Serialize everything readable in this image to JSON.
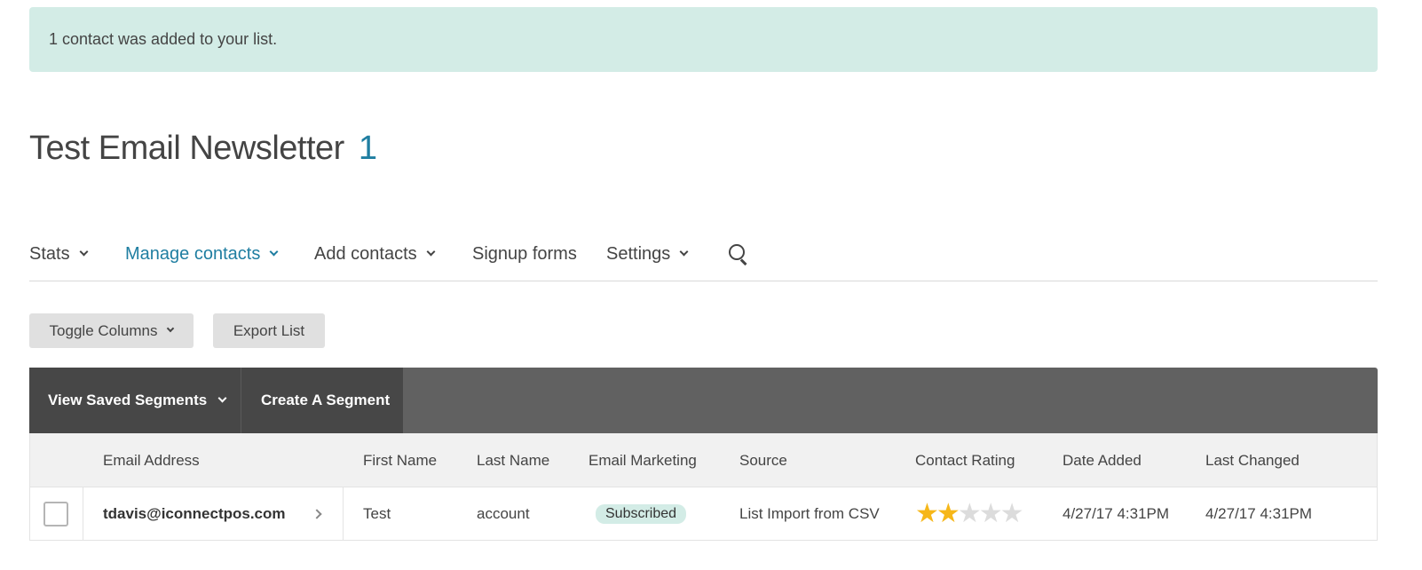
{
  "banner": {
    "message": "1 contact was added to your list."
  },
  "list": {
    "title": "Test Email Newsletter",
    "count": "1"
  },
  "nav": {
    "stats": "Stats",
    "manage_contacts": "Manage contacts",
    "add_contacts": "Add contacts",
    "signup_forms": "Signup forms",
    "settings": "Settings"
  },
  "toolbar": {
    "toggle_columns": "Toggle Columns",
    "export_list": "Export List"
  },
  "segments": {
    "view_saved": "View Saved Segments",
    "create": "Create A Segment"
  },
  "table": {
    "columns": {
      "email": "Email Address",
      "first_name": "First Name",
      "last_name": "Last Name",
      "email_marketing": "Email Marketing",
      "source": "Source",
      "contact_rating": "Contact Rating",
      "date_added": "Date Added",
      "last_changed": "Last Changed"
    },
    "rows": [
      {
        "email": "tdavis@iconnectpos.com",
        "first_name": "Test",
        "last_name": "account",
        "email_marketing": "Subscribed",
        "source": "List Import from CSV",
        "rating": 2,
        "rating_max": 5,
        "date_added": "4/27/17 4:31PM",
        "last_changed": "4/27/17 4:31PM"
      }
    ]
  },
  "colors": {
    "accent": "#1f7ea1",
    "banner_bg": "#d3ece6",
    "star_on": "#f6b719",
    "star_off": "#dcdcdc",
    "segbar_bg": "#616161",
    "segbtn_bg": "#474747"
  },
  "icons": {
    "search": "search-icon",
    "chevron": "chevron-down-icon",
    "row_arrow": "chevron-right-icon",
    "star": "star-icon",
    "checkbox": "checkbox"
  }
}
